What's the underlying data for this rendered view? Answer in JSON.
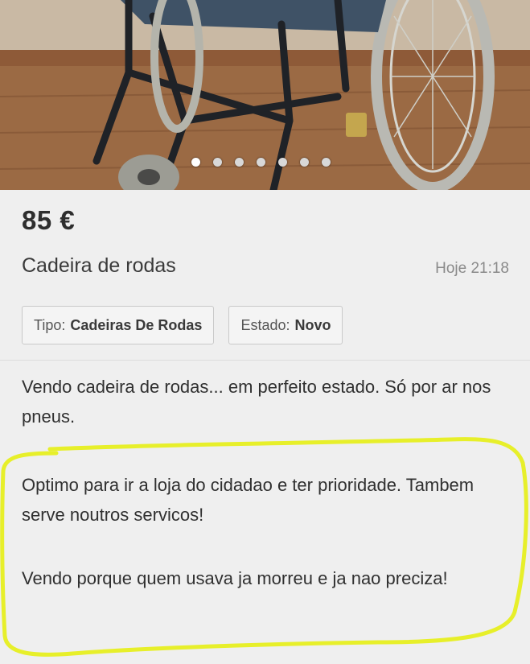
{
  "gallery": {
    "image_count": 7,
    "active_index": 0,
    "subject": "wheelchair"
  },
  "listing": {
    "price": "85 €",
    "title": "Cadeira de rodas",
    "date": "Hoje 21:18",
    "attributes": [
      {
        "key": "Tipo:",
        "value": "Cadeiras De Rodas"
      },
      {
        "key": "Estado:",
        "value": "Novo"
      }
    ],
    "description": {
      "p1": "Vendo cadeira de rodas... em perfeito estado. Só por ar nos pneus.",
      "p2": "Optimo para ir a loja do cidadao e ter prioridade. Tambem serve noutros servicos!",
      "p3": "Vendo porque quem usava ja morreu e ja nao preciza!"
    }
  },
  "colors": {
    "highlight": "#e7ef2a",
    "background": "#efefef"
  }
}
